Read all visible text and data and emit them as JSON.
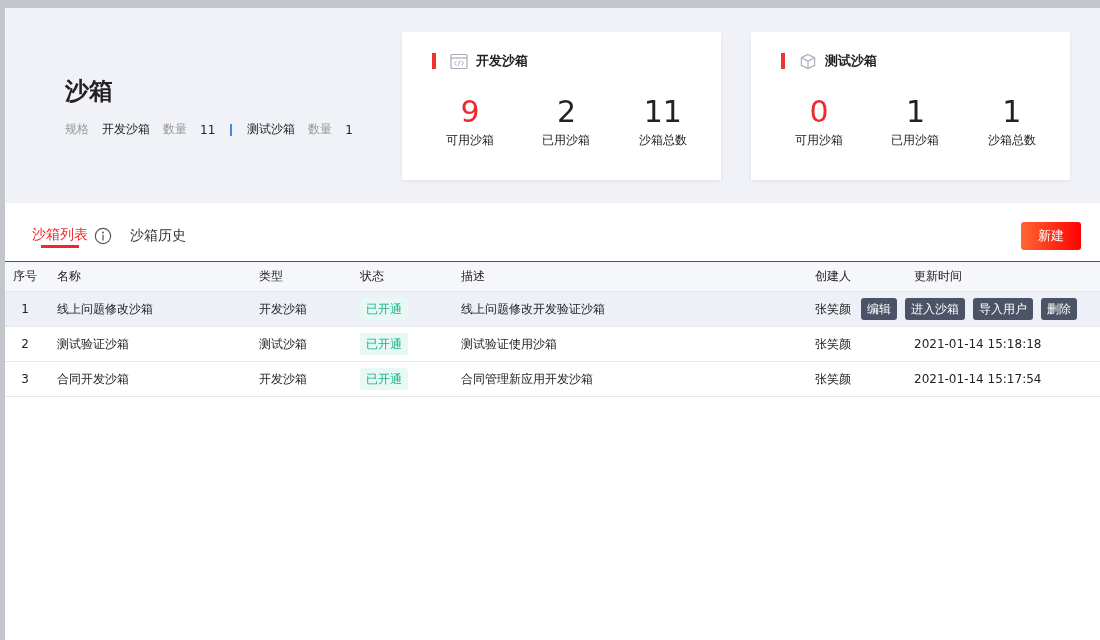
{
  "header": {
    "title": "沙箱",
    "spec_label": "规格",
    "specs": [
      {
        "name": "开发沙箱",
        "count_label": "数量",
        "count": "11"
      },
      {
        "name": "测试沙箱",
        "count_label": "数量",
        "count": "1"
      }
    ]
  },
  "cards": [
    {
      "kind": "code",
      "title": "开发沙箱",
      "stats": [
        {
          "value": "9",
          "label": "可用沙箱",
          "highlight": true
        },
        {
          "value": "2",
          "label": "已用沙箱",
          "highlight": false
        },
        {
          "value": "11",
          "label": "沙箱总数",
          "highlight": false
        }
      ]
    },
    {
      "kind": "cube",
      "title": "测试沙箱",
      "stats": [
        {
          "value": "0",
          "label": "可用沙箱",
          "highlight": true
        },
        {
          "value": "1",
          "label": "已用沙箱",
          "highlight": false
        },
        {
          "value": "1",
          "label": "沙箱总数",
          "highlight": false
        }
      ]
    }
  ],
  "tabs": [
    {
      "label": "沙箱列表",
      "selected": true,
      "info": true
    },
    {
      "label": "沙箱历史",
      "selected": false,
      "info": false
    }
  ],
  "new_button": "新建",
  "table": {
    "columns": [
      "序号",
      "名称",
      "类型",
      "状态",
      "描述",
      "创建人",
      "更新时间"
    ],
    "rows": [
      {
        "index": "1",
        "name": "线上问题修改沙箱",
        "type": "开发沙箱",
        "status": "已开通",
        "description": "线上问题修改开发验证沙箱",
        "creator": "张笑颜",
        "updated": "",
        "hovered": true,
        "actions": [
          "编辑",
          "进入沙箱",
          "导入用户",
          "删除"
        ]
      },
      {
        "index": "2",
        "name": "测试验证沙箱",
        "type": "测试沙箱",
        "status": "已开通",
        "description": "测试验证使用沙箱",
        "creator": "张笑颜",
        "updated": "2021-01-14 15:18:18",
        "hovered": false
      },
      {
        "index": "3",
        "name": "合同开发沙箱",
        "type": "开发沙箱",
        "status": "已开通",
        "description": "合同管理新应用开发沙箱",
        "creator": "张笑颜",
        "updated": "2021-01-14 15:17:54",
        "hovered": false
      }
    ]
  }
}
